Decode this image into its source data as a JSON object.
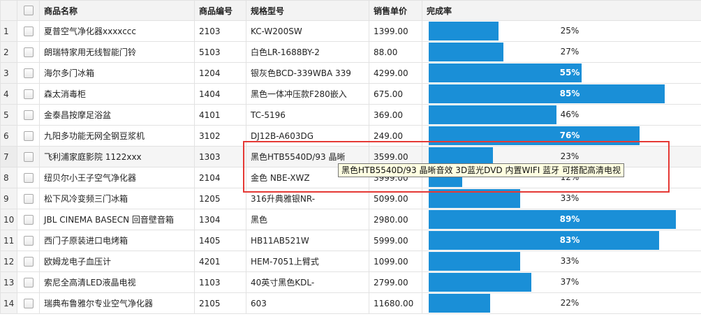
{
  "columns": {
    "product_name": "商品名称",
    "product_code": "商品编号",
    "spec_model": "规格型号",
    "unit_price": "销售单价",
    "completion": "完成率"
  },
  "rows": [
    {
      "index": "1",
      "name": "夏普空气净化器xxxxccc",
      "code": "2103",
      "spec": "KC-W200SW",
      "price": "1399.00",
      "pct_label": "25%",
      "pct": 25
    },
    {
      "index": "2",
      "name": "朗瑞特家用无线智能门铃",
      "code": "5103",
      "spec": "白色LR-1688BY-2",
      "price": "88.00",
      "pct_label": "27%",
      "pct": 27
    },
    {
      "index": "3",
      "name": "海尔多门冰箱",
      "code": "1204",
      "spec": "银灰色BCD-339WBA 339",
      "price": "4299.00",
      "pct_label": "55%",
      "pct": 55
    },
    {
      "index": "4",
      "name": "森太消毒柜",
      "code": "1404",
      "spec": "黑色一体冲压款F280嵌入",
      "price": "675.00",
      "pct_label": "85%",
      "pct": 85
    },
    {
      "index": "5",
      "name": "金泰昌按摩足浴盆",
      "code": "4101",
      "spec": "TC-5196",
      "price": "369.00",
      "pct_label": "46%",
      "pct": 46
    },
    {
      "index": "6",
      "name": "九阳多功能无网全钢豆浆机",
      "code": "3102",
      "spec": "DJ12B-A603DG",
      "price": "249.00",
      "pct_label": "76%",
      "pct": 76
    },
    {
      "index": "7",
      "name": "飞利浦家庭影院 1122xxx",
      "code": "1303",
      "spec": "黑色HTB5540D/93 晶晰",
      "price": "3599.00",
      "pct_label": "23%",
      "pct": 23
    },
    {
      "index": "8",
      "name": "纽贝尔小王子空气净化器",
      "code": "2104",
      "spec": "金色 NBE-XWZ",
      "price": "3999.00",
      "pct_label": "12%",
      "pct": 12
    },
    {
      "index": "9",
      "name": "松下风冷变频三门冰箱",
      "code": "1205",
      "spec": "316升典雅银NR-",
      "price": "5099.00",
      "pct_label": "33%",
      "pct": 33
    },
    {
      "index": "10",
      "name": "JBL CINEMA BASECN 回音壁音箱",
      "code": "1304",
      "spec": "黑色",
      "price": "2980.00",
      "pct_label": "89%",
      "pct": 89
    },
    {
      "index": "11",
      "name": "西门子原装进口电烤箱",
      "code": "1405",
      "spec": "HB11AB521W",
      "price": "5999.00",
      "pct_label": "83%",
      "pct": 83
    },
    {
      "index": "12",
      "name": "欧姆龙电子血压计",
      "code": "4201",
      "spec": "HEM-7051上臂式",
      "price": "1099.00",
      "pct_label": "33%",
      "pct": 33
    },
    {
      "index": "13",
      "name": "索尼全高清LED液晶电视",
      "code": "1103",
      "spec": "40英寸黑色KDL-",
      "price": "2799.00",
      "pct_label": "37%",
      "pct": 37
    },
    {
      "index": "14",
      "name": "瑞典布鲁雅尔专业空气净化器",
      "code": "2105",
      "spec": "603",
      "price": "11680.00",
      "pct_label": "22%",
      "pct": 22
    }
  ],
  "tooltip": {
    "text": "黑色HTB5540D/93 晶晰音效 3D蓝光DVD 内置WIFI 蓝牙 可搭配高清电视"
  },
  "colors": {
    "bar": "#1a8fd7",
    "highlight": "#e53935",
    "tooltip_bg": "#ffffe1"
  }
}
